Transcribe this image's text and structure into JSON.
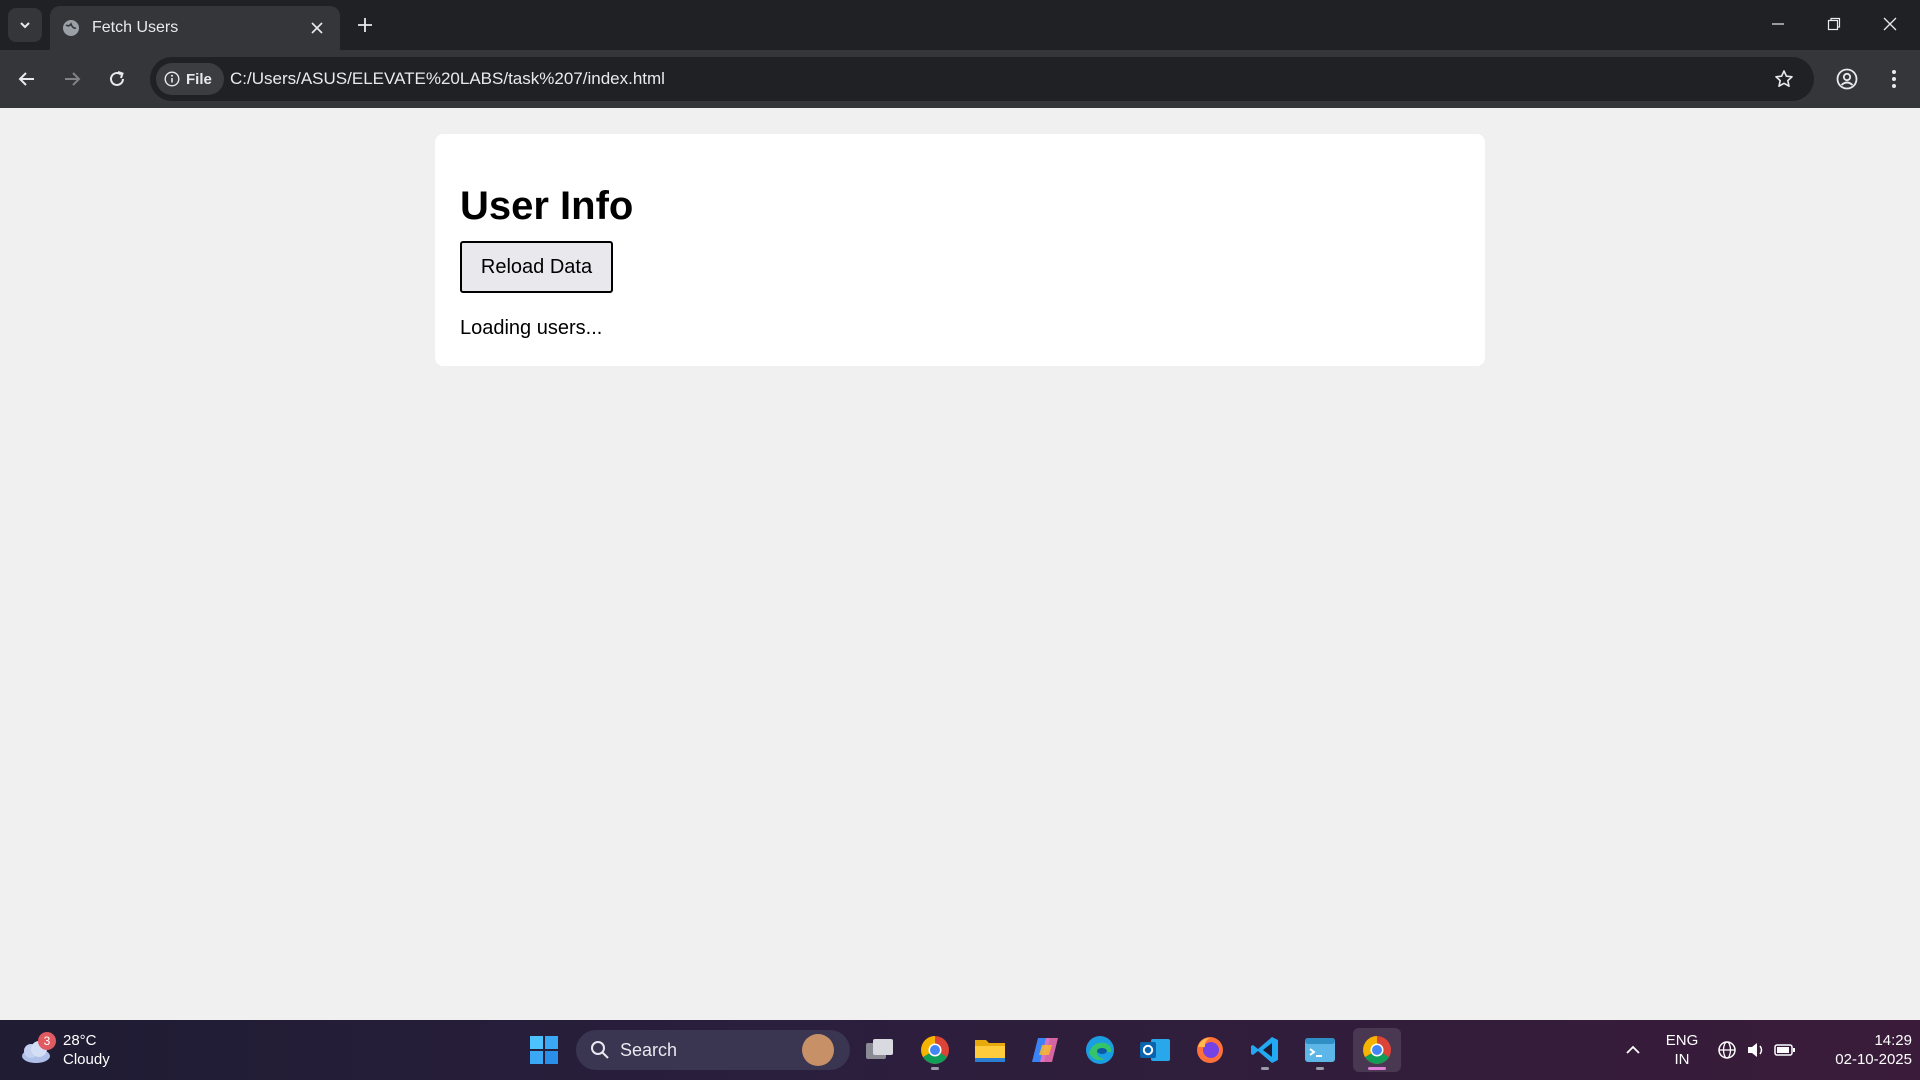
{
  "browser": {
    "tab": {
      "title": "Fetch Users"
    },
    "address_bar": {
      "site_info_label": "File",
      "url": "C:/Users/ASUS/ELEVATE%20LABS/task%207/index.html"
    }
  },
  "page": {
    "heading": "User Info",
    "reload_button_label": "Reload Data",
    "status": "Loading users..."
  },
  "taskbar": {
    "weather": {
      "badge_count": "3",
      "temperature": "28°C",
      "condition": "Cloudy"
    },
    "search_placeholder": "Search",
    "pinned_apps": [
      "task-view",
      "chrome",
      "file-explorer",
      "copilot",
      "edge",
      "outlook",
      "firefox",
      "vscode",
      "terminal",
      "chrome-active"
    ],
    "tray": {
      "language": "ENG",
      "region": "IN",
      "time": "14:29",
      "date": "02-10-2025"
    }
  },
  "colors": {
    "page_background": "#f0f0f0",
    "card_background": "#ffffff",
    "chrome_dark": "#202124",
    "chrome_toolbar": "#35363a",
    "button_face": "#e9e9ed"
  }
}
